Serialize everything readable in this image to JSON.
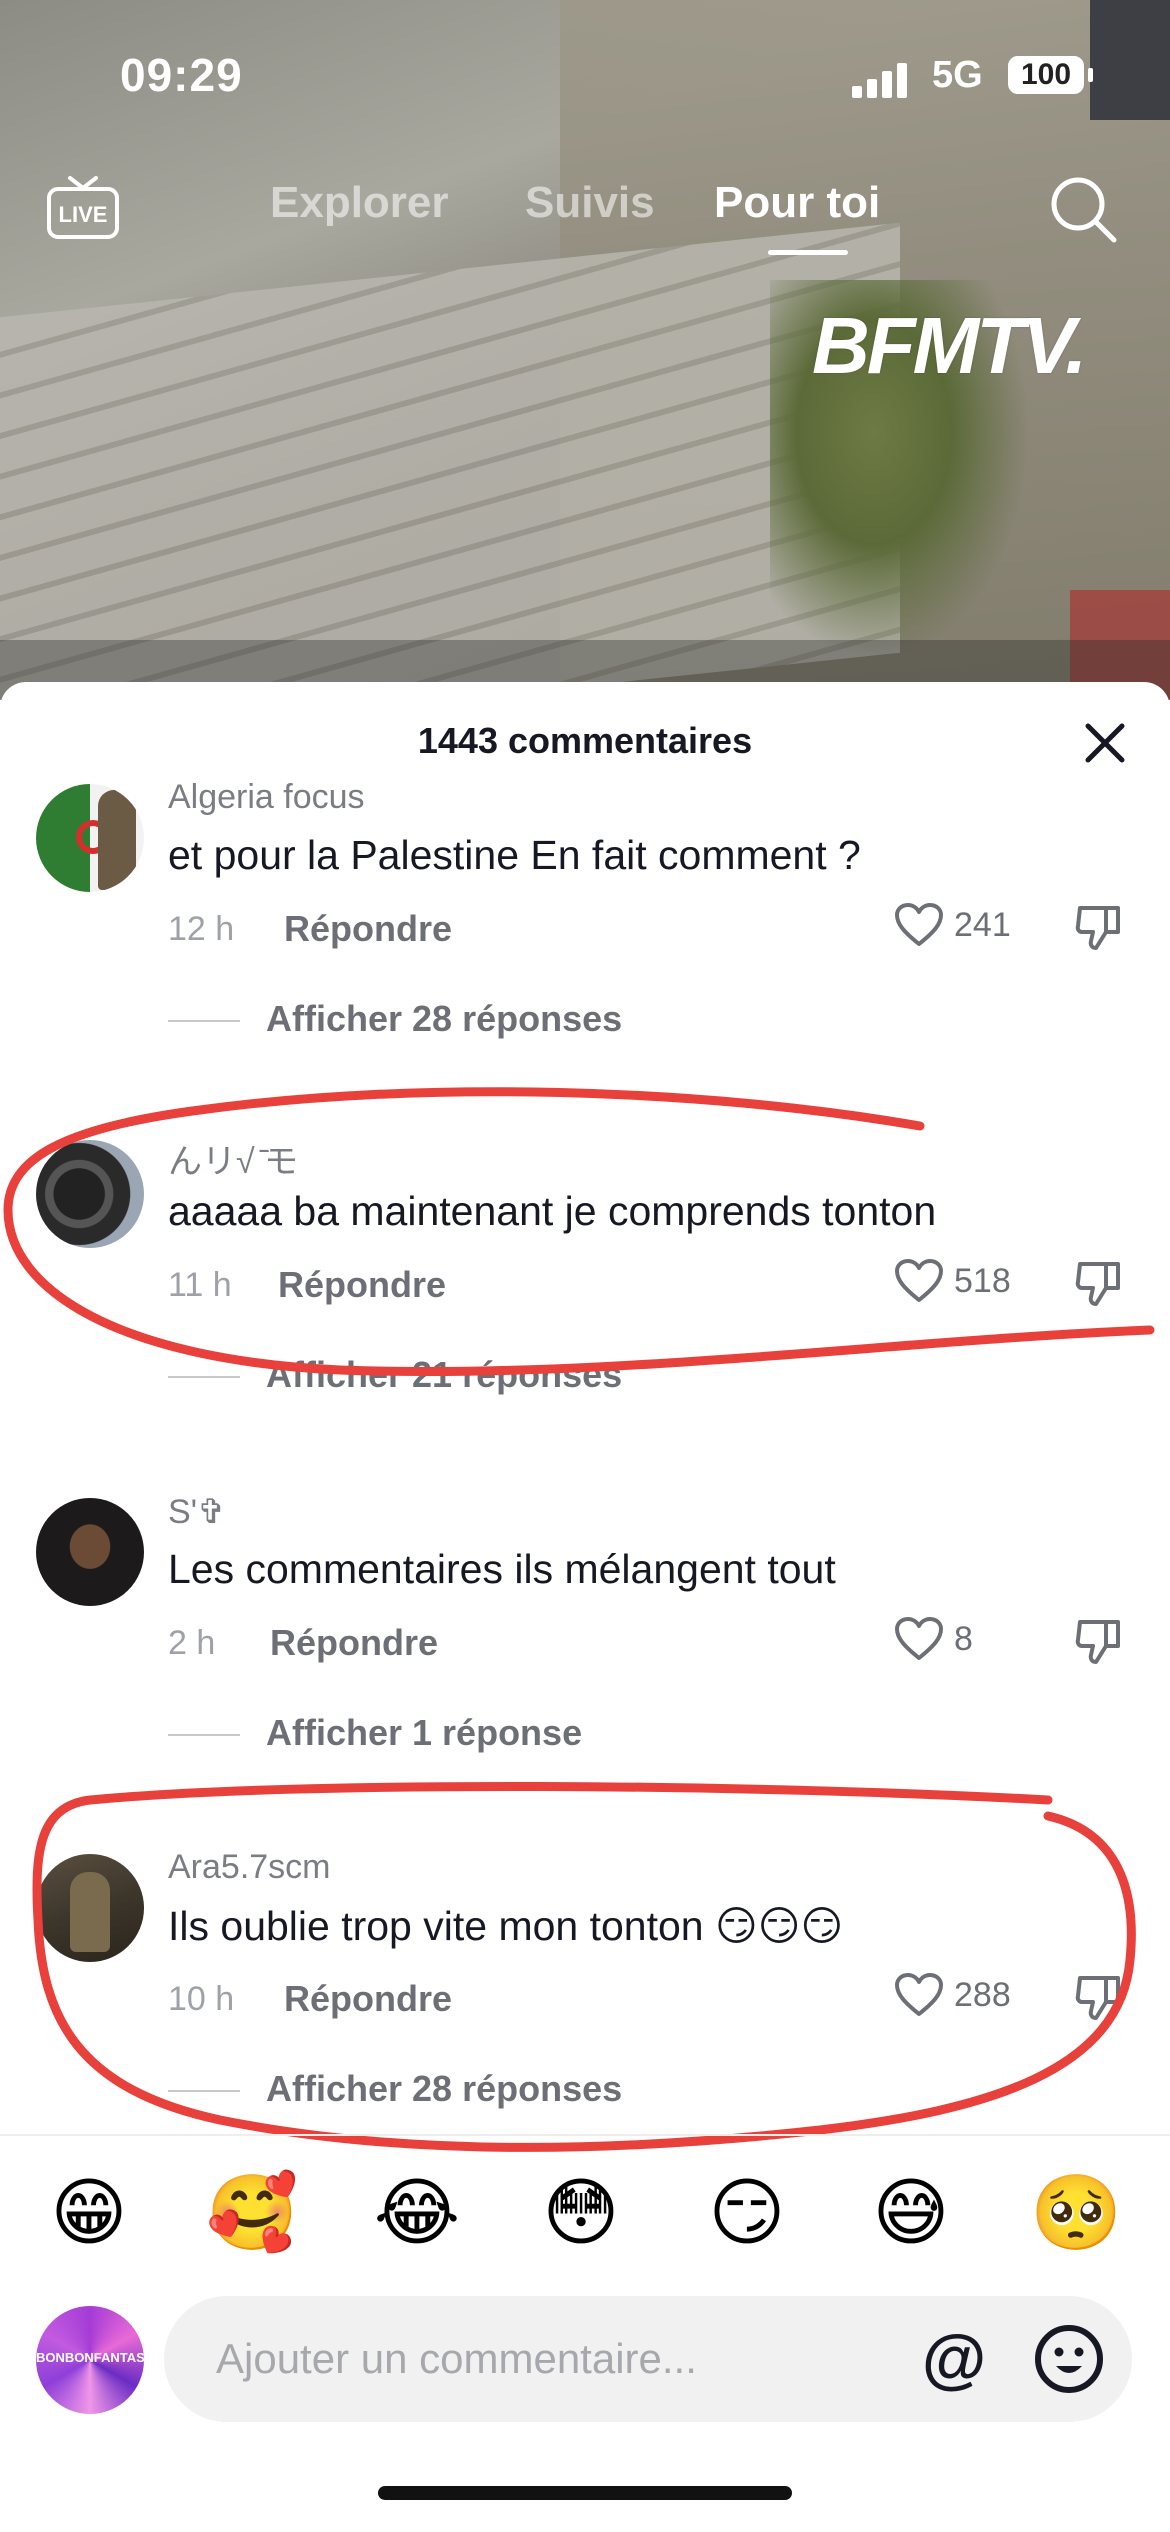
{
  "status_bar": {
    "time": "09:29",
    "network": "5G",
    "battery": "100"
  },
  "top_nav": {
    "live_label": "LIVE",
    "tabs": [
      {
        "label": "Explorer",
        "active": false
      },
      {
        "label": "Suivis",
        "active": false
      },
      {
        "label": "Pour toi",
        "active": true
      }
    ]
  },
  "video": {
    "watermark": "BFMTV."
  },
  "comments_sheet": {
    "title": "1443 commentaires",
    "reply_label": "Répondre",
    "comments": [
      {
        "username": "Algeria focus",
        "text": "et pour la Palestine En fait comment ?",
        "time": "12 h",
        "likes": "241",
        "view_replies": "Afficher 28 réponses"
      },
      {
        "username": "んリ√ ̄モ",
        "text": "aaaaa ba maintenant je comprends tonton",
        "time": "11 h",
        "likes": "518",
        "view_replies": "Afficher 21 réponses"
      },
      {
        "username": "S'✞",
        "text": "Les commentaires ils mélangent tout",
        "time": "2 h",
        "likes": "8",
        "view_replies": "Afficher 1 réponse"
      },
      {
        "username": "Ara5.7scm",
        "text": "Ils oublie trop vite mon tonton 😏😏😏",
        "time": "10 h",
        "likes": "288",
        "view_replies": "Afficher 28 réponses"
      }
    ]
  },
  "emoji_bar": [
    "😁",
    "🥰",
    "😂",
    "😳",
    "😏",
    "😅",
    "🥺"
  ],
  "composer": {
    "placeholder": "Ajouter un commentaire...",
    "avatar_text": "BONBONFANTASY",
    "mention_symbol": "@"
  },
  "colors": {
    "annotation_red": "#e8413c",
    "text_primary": "#161823",
    "text_secondary": "#6d6f77"
  }
}
